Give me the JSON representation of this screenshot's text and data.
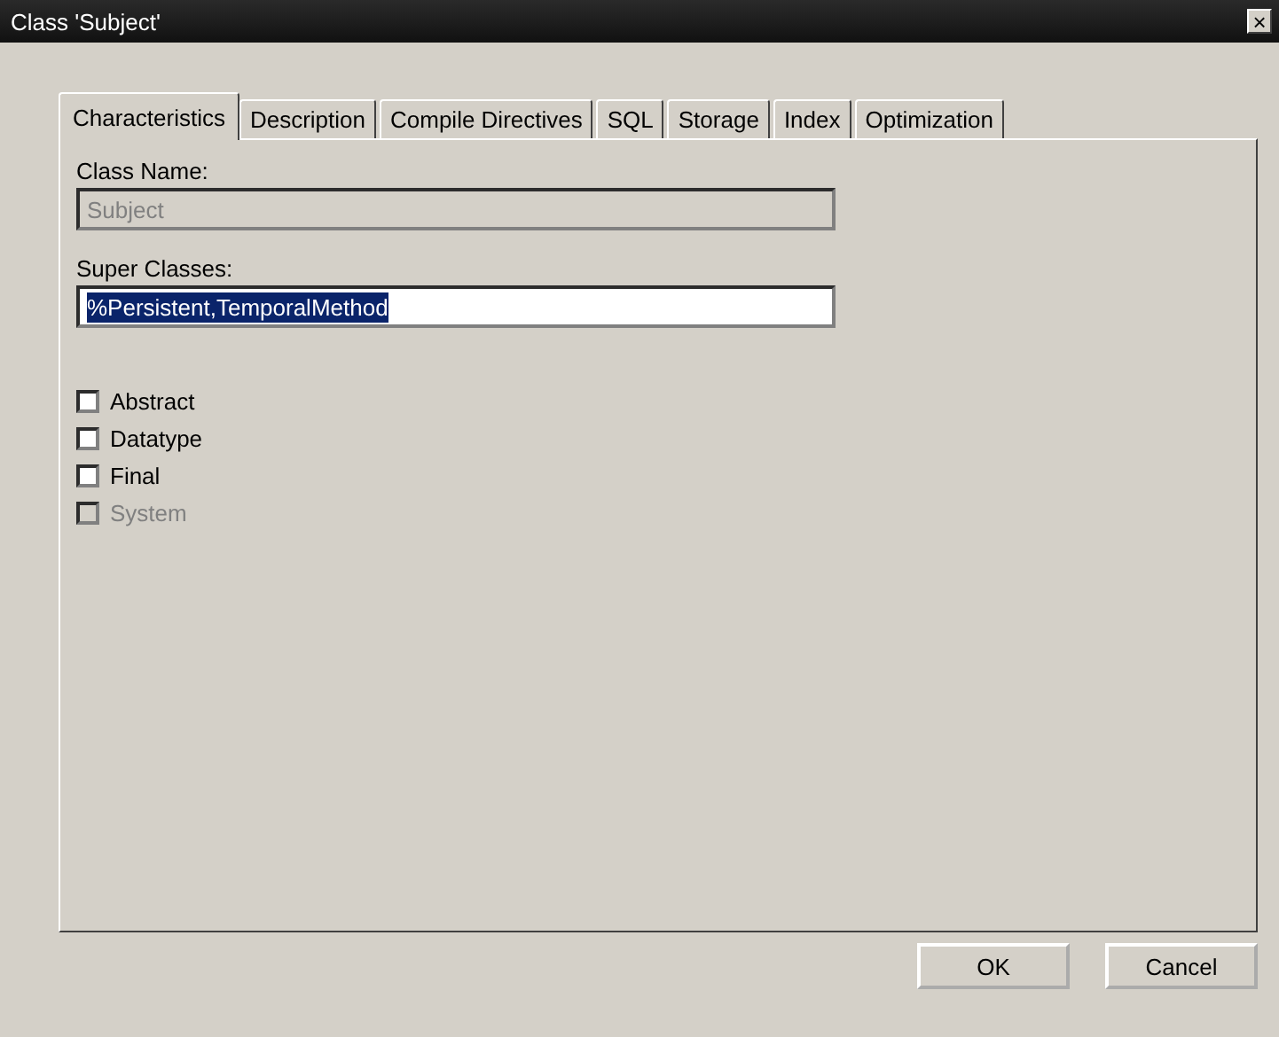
{
  "window": {
    "title": "Class 'Subject'",
    "close": "×"
  },
  "tabs": [
    {
      "label": "Characteristics",
      "selected": true
    },
    {
      "label": "Description",
      "selected": false
    },
    {
      "label": "Compile Directives",
      "selected": false
    },
    {
      "label": "SQL",
      "selected": false
    },
    {
      "label": "Storage",
      "selected": false
    },
    {
      "label": "Index",
      "selected": false
    },
    {
      "label": "Optimization",
      "selected": false
    }
  ],
  "class_name": {
    "label": "Class Name:",
    "value": "Subject",
    "disabled": true
  },
  "super_classes": {
    "label": "Super Classes:",
    "value": "%Persistent,TemporalMethod",
    "text_selected": true
  },
  "checkboxes": [
    {
      "label": "Abstract",
      "checked": false,
      "disabled": false
    },
    {
      "label": "Datatype",
      "checked": false,
      "disabled": false
    },
    {
      "label": "Final",
      "checked": false,
      "disabled": false
    },
    {
      "label": "System",
      "checked": false,
      "disabled": true
    }
  ],
  "buttons": [
    "OK",
    "Cancel"
  ]
}
